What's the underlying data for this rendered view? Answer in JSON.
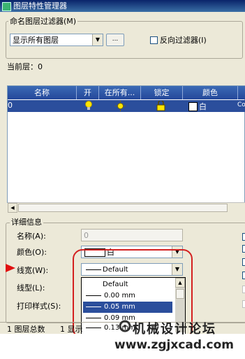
{
  "window": {
    "title": "图层特性管理器"
  },
  "filter_group": {
    "title": "命名图层过滤器(M)",
    "combo_value": "显示所有图层",
    "browse_label": "...",
    "invert_label": "反向过滤器(I)"
  },
  "current_layer": "当前层：0",
  "table": {
    "columns": [
      "名称",
      "开",
      "在所有...",
      "锁定",
      "颜色"
    ],
    "rows": [
      {
        "name": "0",
        "color_name": "白",
        "trailing": "Co"
      }
    ]
  },
  "details": {
    "title": "详细信息",
    "name_label": "名称(A):",
    "name_value": "0",
    "color_label": "颜色(O):",
    "color_value": "白",
    "lineweight_label": "线宽(W):",
    "lineweight_value": "Default",
    "linetype_label": "线型(L):",
    "plotstyle_label": "打印样式(S):"
  },
  "lineweight_dropdown": {
    "options": [
      "Default",
      "0.00 mm",
      "0.05 mm",
      "0.09 mm",
      "0.13 mm"
    ],
    "selected": "0.05 mm"
  },
  "status": {
    "total": "1 图层总数",
    "shown": "1 显示"
  },
  "watermark": {
    "logo_text": "机械设计论坛",
    "url": "www.zgjxcad.com"
  },
  "colors": {
    "title_bar": "#0a246a",
    "selection": "#2b4e9c",
    "highlight_ring": "#d42020",
    "pointer_arrow": "#e01010"
  },
  "icons": {
    "window": "layer-manager-icon",
    "on": "lightbulb-icon",
    "freeze": "sun-icon",
    "lock": "padlock-icon",
    "pointer": "red-triangle-arrow-icon"
  }
}
